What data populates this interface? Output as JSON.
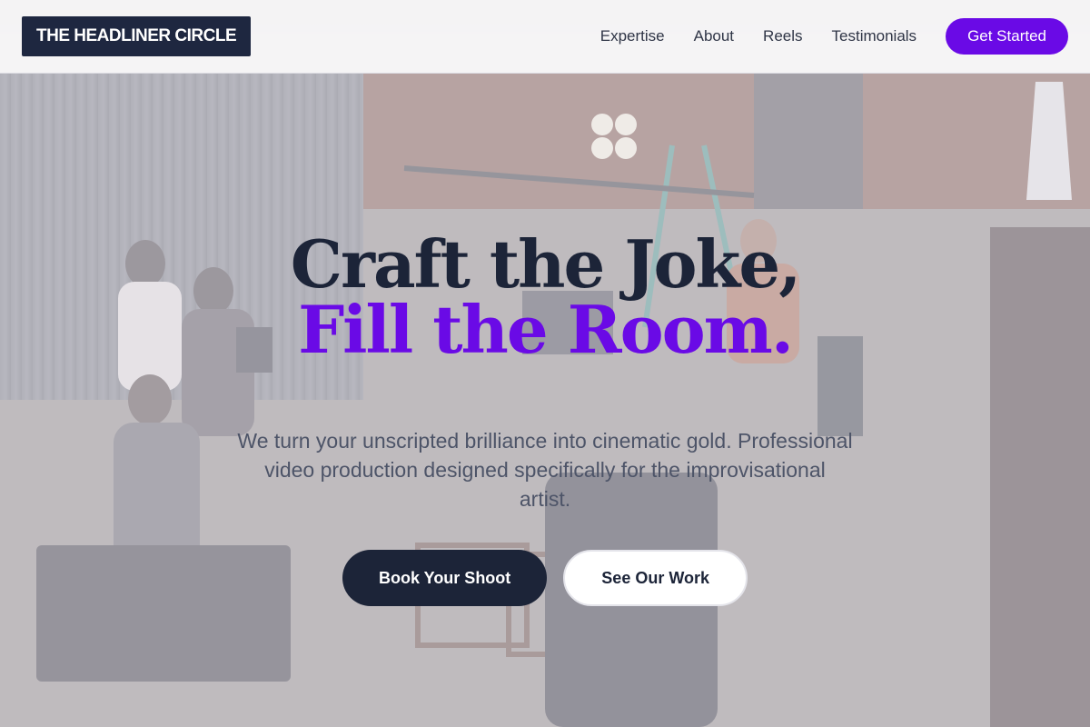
{
  "nav": {
    "logo": "THE HEADLINER CIRCLE",
    "links": [
      "Expertise",
      "About",
      "Reels",
      "Testimonials"
    ],
    "cta_label": "Get Started"
  },
  "hero": {
    "headline_line1": "Craft the Joke,",
    "headline_line2": "Fill the Room.",
    "subtitle": "We turn your unscripted brilliance into cinematic gold. Professional video production designed specifically for the improvisational artist.",
    "primary_button": "Book Your Shoot",
    "secondary_button": "See Our Work",
    "background_image": "film-production-studio-photo"
  },
  "colors": {
    "accent": "#6a0ae6",
    "navy": "#1c2438",
    "logo_bg": "#1e2740",
    "text_muted": "#4d5468"
  }
}
